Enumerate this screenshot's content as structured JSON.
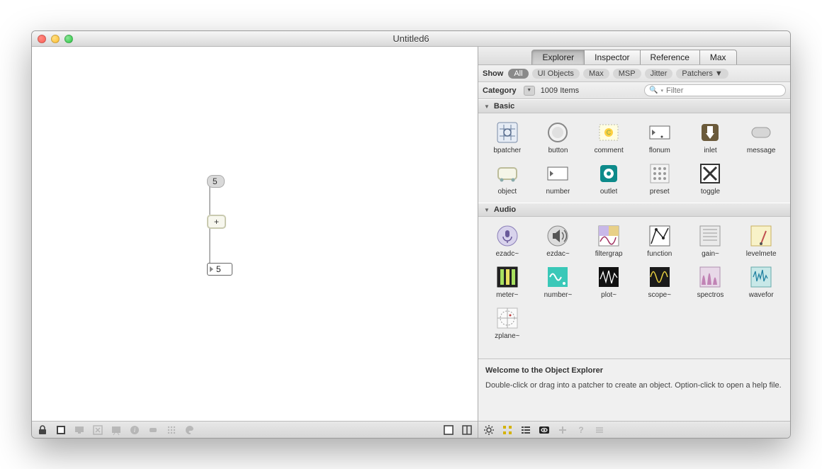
{
  "window": {
    "title": "Untitled6"
  },
  "tabs": [
    "Explorer",
    "Inspector",
    "Reference",
    "Max"
  ],
  "active_tab": "Explorer",
  "show": {
    "label": "Show",
    "filters": [
      "All",
      "UI Objects",
      "Max",
      "MSP",
      "Jitter",
      "Patchers ▼"
    ],
    "active": "All"
  },
  "category": {
    "label": "Category",
    "count": "1009 Items"
  },
  "search": {
    "placeholder": "Filter"
  },
  "sections": [
    {
      "name": "Basic",
      "items": [
        "bpatcher",
        "button",
        "comment",
        "flonum",
        "inlet",
        "message",
        "object",
        "number",
        "outlet",
        "preset",
        "toggle"
      ]
    },
    {
      "name": "Audio",
      "items": [
        "ezadc~",
        "ezdac~",
        "filtergrap",
        "function",
        "gain~",
        "levelmete",
        "meter~",
        "number~",
        "plot~",
        "scope~",
        "spectros",
        "wavefor",
        "zplane~"
      ]
    }
  ],
  "info": {
    "title": "Welcome to the Object Explorer",
    "text": "Double-click or drag into a patcher to create an object. Option-click to open a help file."
  },
  "patch": {
    "msg": "5",
    "op": "+",
    "num": "5"
  }
}
